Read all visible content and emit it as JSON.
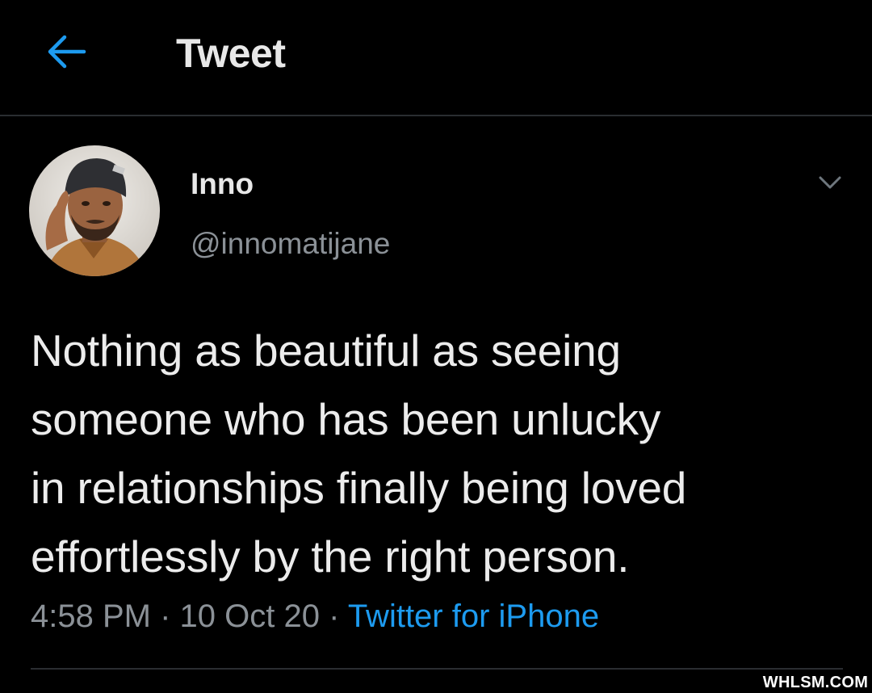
{
  "header": {
    "back_icon": "arrow-left-icon",
    "title": "Tweet",
    "accent_color": "#1d9bf0"
  },
  "tweet": {
    "author": {
      "display_name": "Inno",
      "handle": "@innomatijane",
      "avatar": "profile-photo"
    },
    "menu_icon": "chevron-down-icon",
    "text": "Nothing as beautiful as seeing\nsomeone who has been unlucky\nin relationships finally being loved\neffortlessly by the right person.",
    "time": "4:58 PM",
    "separator": "·",
    "date": "10 Oct 20",
    "source": "Twitter for iPhone"
  },
  "watermark": "WHLSM.COM"
}
